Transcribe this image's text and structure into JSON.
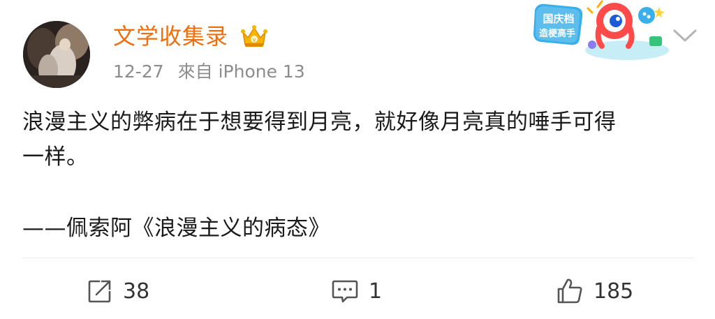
{
  "post": {
    "author": {
      "username": "文学收集录",
      "badge_icon": "crown-icon"
    },
    "meta": {
      "date": "12-27",
      "source": "來自 iPhone 13"
    },
    "promo_badge": {
      "line1": "国庆档",
      "line2": "造梗高手"
    },
    "text": {
      "line1": "浪漫主义的弊病在于想要得到月亮，就好像月亮真的唾手可得",
      "line2": "一样。",
      "quote": "——佩索阿《浪漫主义的病态》"
    },
    "actions": {
      "repost_count": "38",
      "comment_count": "1",
      "like_count": "185"
    }
  },
  "colors": {
    "username": "#f06e0c",
    "meta": "#8c8c8c",
    "text": "#1a1a1a",
    "divider": "#ececec"
  }
}
